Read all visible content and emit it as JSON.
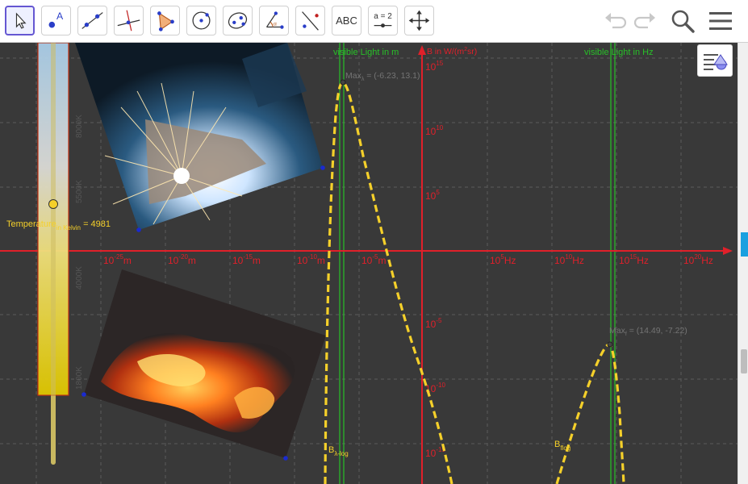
{
  "toolbar": {
    "tools": [
      {
        "name": "move-tool",
        "icon": "arrow-cursor-icon",
        "selected": true
      },
      {
        "name": "point-tool",
        "icon": "point-icon",
        "label": "A"
      },
      {
        "name": "line-tool",
        "icon": "line-icon"
      },
      {
        "name": "perpendicular-line-tool",
        "icon": "perpendicular-icon"
      },
      {
        "name": "polygon-tool",
        "icon": "polygon-icon"
      },
      {
        "name": "circle-tool",
        "icon": "circle-icon"
      },
      {
        "name": "ellipse-tool",
        "icon": "ellipse-icon"
      },
      {
        "name": "angle-tool",
        "icon": "angle-icon"
      },
      {
        "name": "reflect-tool",
        "icon": "reflect-icon"
      },
      {
        "name": "text-tool",
        "icon": "text-icon",
        "label": "ABC"
      },
      {
        "name": "slider-tool",
        "icon": "slider-icon",
        "label": "a = 2"
      },
      {
        "name": "move-view-tool",
        "icon": "move-arrows-icon"
      }
    ],
    "right_icons": [
      "undo-icon",
      "redo-icon",
      "search-icon",
      "menu-icon"
    ]
  },
  "graphics": {
    "background": "#393939",
    "axis_color": "#e0202a",
    "curve_color": "#f5d02a",
    "visible_line_color": "#28c028",
    "temperature_color": "#f5d02a",
    "label_visible_wavelength": "visible Light in m",
    "label_visible_frequency": "visible Light in Hz",
    "y_axis_label_prefix": "B in W/(m",
    "y_axis_label_sup": "2",
    "y_axis_label_suffix": "sr)",
    "max_lambda_label": "Max",
    "max_lambda_sub": "λ",
    "max_lambda_value": " = (-6.23, 13.1)",
    "max_f_label": "Max",
    "max_f_sub": "f",
    "max_f_value": " = (14.49, -7.22)",
    "b_lambda_label": "B",
    "b_lambda_sub": "λ-log",
    "b_f_label": "B",
    "b_f_sub": "flog",
    "temperature_label": "Temperature",
    "temperature_sub": "in Kelvin",
    "temperature_value": " = 4981",
    "slider_ticks": [
      "8000K",
      "5500K",
      "4000K",
      "1800K"
    ],
    "y_ticks": [
      {
        "base": "10",
        "exp": "15"
      },
      {
        "base": "10",
        "exp": "10"
      },
      {
        "base": "10",
        "exp": "5"
      },
      {
        "base": "10",
        "exp": "-5"
      },
      {
        "base": "10",
        "exp": "-10"
      },
      {
        "base": "10",
        "exp": "-15"
      }
    ],
    "x_ticks_wavelength": [
      {
        "base": "10",
        "exp": "-25",
        "unit": "m"
      },
      {
        "base": "10",
        "exp": "-20",
        "unit": "m"
      },
      {
        "base": "10",
        "exp": "-15",
        "unit": "m"
      },
      {
        "base": "10",
        "exp": "-10",
        "unit": "m"
      },
      {
        "base": "10",
        "exp": "-5",
        "unit": "m"
      }
    ],
    "x_ticks_frequency": [
      {
        "base": "10",
        "exp": "5",
        "unit": "Hz"
      },
      {
        "base": "10",
        "exp": "10",
        "unit": "Hz"
      },
      {
        "base": "10",
        "exp": "15",
        "unit": "Hz"
      },
      {
        "base": "10",
        "exp": "20",
        "unit": "Hz"
      }
    ]
  }
}
